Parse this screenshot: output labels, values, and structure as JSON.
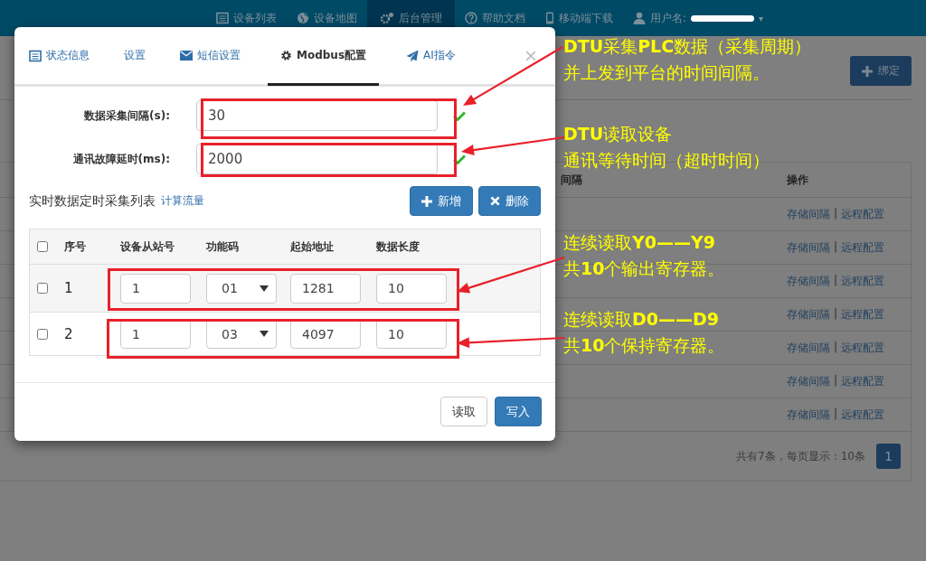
{
  "nav": {
    "items": [
      {
        "label": "设备列表",
        "selected": false
      },
      {
        "label": "设备地图",
        "selected": false
      },
      {
        "label": "后台管理",
        "selected": true
      },
      {
        "label": "帮助文档",
        "selected": false
      },
      {
        "label": "移动端下载",
        "selected": false
      },
      {
        "label": "用户名:",
        "selected": false,
        "caret": "▾"
      }
    ]
  },
  "background": {
    "bind_button": "绑定",
    "columns": [
      "间隔",
      "操作"
    ],
    "rows": [
      {
        "link_1": "存储间隔",
        "separator": "|",
        "link_2": "远程配置"
      },
      {
        "link_1": "存储间隔",
        "separator": "|",
        "link_2": "远程配置"
      },
      {
        "link_1": "存储间隔",
        "separator": "|",
        "link_2": "远程配置"
      },
      {
        "link_1": "存储间隔",
        "separator": "|",
        "link_2": "远程配置"
      },
      {
        "link_1": "存储间隔",
        "separator": "|",
        "link_2": "远程配置"
      },
      {
        "link_1": "存储间隔",
        "separator": "|",
        "link_2": "远程配置"
      },
      {
        "link_1": "存储间隔",
        "separator": "|",
        "link_2": "远程配置"
      }
    ],
    "pagination": {
      "summary": "共有7条，每页显示：10条",
      "pages": [
        {
          "label": "1",
          "selected": true
        }
      ]
    }
  },
  "modal": {
    "tabs": [
      {
        "label": "状态信息",
        "selected": false
      },
      {
        "label": "设置",
        "selected": false
      },
      {
        "label": "短信设置",
        "selected": false
      },
      {
        "label": "Modbus配置",
        "selected": true
      },
      {
        "label": "AI指令",
        "selected": false
      }
    ],
    "close": "×",
    "fields": [
      {
        "label": "数据采集间隔(s):",
        "value": "30",
        "valid": true
      },
      {
        "label": "通讯故障延时(ms):",
        "value": "2000",
        "valid": true
      }
    ],
    "section_title": "实时数据定时采集列表",
    "section_link": "计算流量",
    "add_button": "新增",
    "delete_button": "删除",
    "table": {
      "select_all": false,
      "columns": [
        "序号",
        "设备从站号",
        "功能码",
        "起始地址",
        "数据长度"
      ],
      "rows": [
        {
          "checked": false,
          "index": "1",
          "slave": "1",
          "function": "01",
          "address": "1281",
          "length": "10"
        },
        {
          "checked": false,
          "index": "2",
          "slave": "1",
          "function": "03",
          "address": "4097",
          "length": "10"
        }
      ]
    },
    "read_button": "读取",
    "write_button": "写入"
  },
  "annotations": [
    {
      "lines": [
        "**DTU**采集**PLC**数据（采集周期）",
        "并上发到平台的时间间隔。"
      ]
    },
    {
      "lines": [
        "**DTU**读取设备",
        "通讯等待时间（超时时间）"
      ]
    },
    {
      "lines": [
        "连续读取**Y0——Y9**",
        "共**10**个输出寄存器。"
      ]
    },
    {
      "lines": [
        "连续读取**D0——D9**",
        "共**10**个保持寄存器。"
      ]
    }
  ]
}
